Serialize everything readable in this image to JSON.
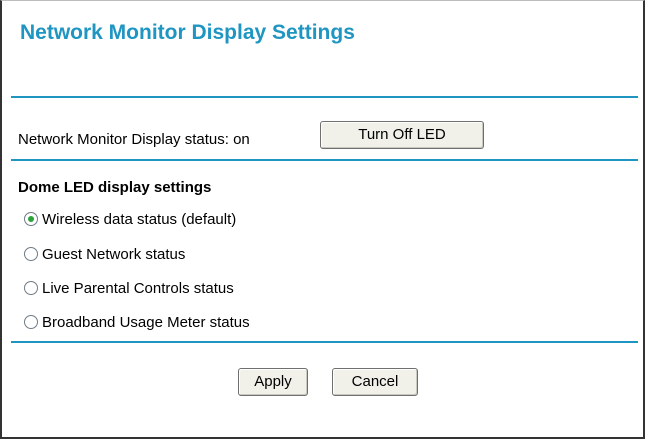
{
  "page": {
    "title": "Network Monitor Display Settings"
  },
  "status": {
    "label": "Network Monitor Display status: on",
    "toggle_button_label": "Turn Off LED"
  },
  "dome_led": {
    "heading": "Dome LED display settings",
    "options": [
      {
        "label": "Wireless data status (default)",
        "selected": true
      },
      {
        "label": "Guest Network status",
        "selected": false
      },
      {
        "label": "Live Parental Controls status",
        "selected": false
      },
      {
        "label": "Broadband Usage Meter status",
        "selected": false
      }
    ]
  },
  "actions": {
    "apply_label": "Apply",
    "cancel_label": "Cancel"
  },
  "colors": {
    "accent": "#1f95c2",
    "radio_selected": "#2aa43a",
    "button_face": "#f1f1ea"
  }
}
